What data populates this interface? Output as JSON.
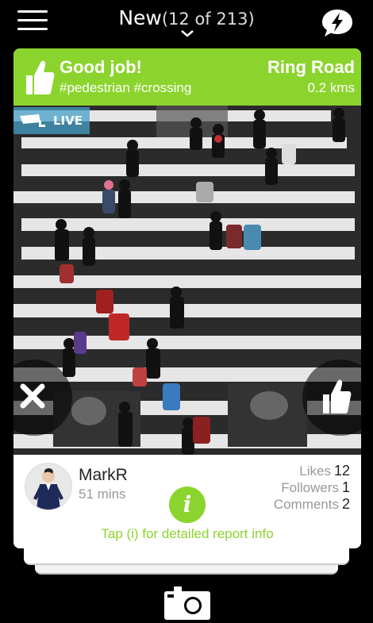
{
  "header": {
    "title": "New",
    "counter": "(12 of 213)"
  },
  "report": {
    "banner_title": "Good job!",
    "tags": "#pedestrian #crossing",
    "location": "Ring Road",
    "distance": "0.2 kms",
    "live_label": "LIVE",
    "accent_color": "#8bd42d"
  },
  "user": {
    "name": "MarkR",
    "time_ago": "51 mins"
  },
  "stats": {
    "likes_label": "Likes",
    "likes_value": "12",
    "followers_label": "Followers",
    "followers_value": "1",
    "comments_label": "Comments",
    "comments_value": "2"
  },
  "info": {
    "icon_glyph": "i",
    "hint": "Tap (i) for detailed report info"
  },
  "icons": [
    "menu-icon",
    "chevron-down-icon",
    "lightning-icon",
    "thumbs-up-icon",
    "cctv-camera-icon",
    "close-icon",
    "info-icon",
    "camera-icon"
  ]
}
